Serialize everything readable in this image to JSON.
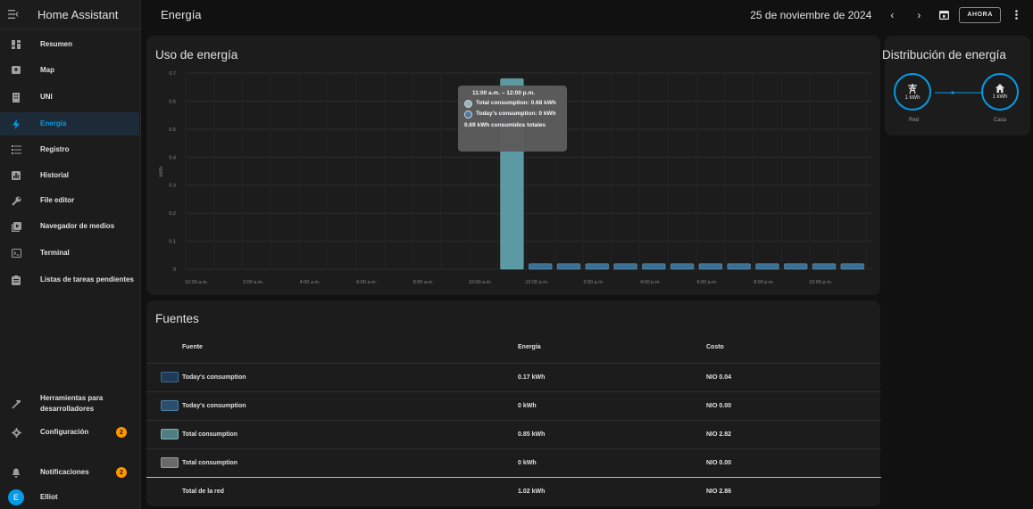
{
  "sidebar": {
    "title": "Home Assistant",
    "items": [
      {
        "label": "Resumen",
        "icon": "dashboard-icon"
      },
      {
        "label": "Map",
        "icon": "map-icon"
      },
      {
        "label": "UNI",
        "icon": "building-icon"
      },
      {
        "label": "Energía",
        "icon": "lightning-icon"
      },
      {
        "label": "Registro",
        "icon": "list-icon"
      },
      {
        "label": "Historial",
        "icon": "chart-box-icon"
      },
      {
        "label": "File editor",
        "icon": "wrench-icon"
      },
      {
        "label": "Navegador de medios",
        "icon": "play-box-icon"
      },
      {
        "label": "Terminal",
        "icon": "console-icon"
      },
      {
        "label": "Listas de tareas pendientes",
        "icon": "clipboard-list-icon"
      }
    ],
    "dev_tools": {
      "line1": "Herramientas para",
      "line2": "desarrolladores"
    },
    "config": {
      "label": "Configuración",
      "badge": "2"
    },
    "notifications": {
      "label": "Notificaciones",
      "badge": "2"
    },
    "user": {
      "initial": "E",
      "name": "Elliot"
    },
    "accent_color": "#039be5"
  },
  "topbar": {
    "title": "Energía",
    "date": "25 de noviembre de 2024",
    "now_label": "AHORA"
  },
  "usage_card": {
    "title": "Uso de energía"
  },
  "chart_data": {
    "type": "bar",
    "ylabel": "kWh",
    "yticks": [
      "0",
      "0.1",
      "0.2",
      "0.3",
      "0.4",
      "0.5",
      "0.6",
      "0.7"
    ],
    "ylim": [
      0,
      0.7
    ],
    "xticks": [
      "12:00 a.m.",
      "2:00 a.m.",
      "4:00 a.m.",
      "6:00 a.m.",
      "8:00 a.m.",
      "10:00 a.m.",
      "12:00 p.m.",
      "2:00 p.m.",
      "4:00 p.m.",
      "6:00 p.m.",
      "8:00 p.m.",
      "10:00 p.m."
    ],
    "hours": [
      "12:00 a.m.",
      "1:00 a.m.",
      "2:00 a.m.",
      "3:00 a.m.",
      "4:00 a.m.",
      "5:00 a.m.",
      "6:00 a.m.",
      "7:00 a.m.",
      "8:00 a.m.",
      "9:00 a.m.",
      "10:00 a.m.",
      "11:00 a.m.",
      "12:00 p.m.",
      "1:00 p.m.",
      "2:00 p.m.",
      "3:00 p.m.",
      "4:00 p.m.",
      "5:00 p.m.",
      "6:00 p.m.",
      "7:00 p.m.",
      "8:00 p.m.",
      "9:00 p.m.",
      "10:00 p.m.",
      "11:00 p.m."
    ],
    "series": [
      {
        "name": "Total consumption",
        "color": "#5b9aa3",
        "values": [
          0,
          0,
          0,
          0,
          0,
          0,
          0,
          0,
          0,
          0,
          0,
          0.68,
          0,
          0,
          0,
          0,
          0,
          0,
          0,
          0,
          0,
          0,
          0,
          0
        ]
      },
      {
        "name": "Today's consumption",
        "color": "#3a6f96",
        "values": [
          0,
          0,
          0,
          0,
          0,
          0,
          0,
          0,
          0,
          0,
          0,
          0,
          0.02,
          0.02,
          0.02,
          0.02,
          0.02,
          0.02,
          0.02,
          0.02,
          0.02,
          0.02,
          0.02,
          0.02
        ]
      }
    ],
    "grid": true
  },
  "tooltip": {
    "header": "11:00 a.m. – 12:00 p.m.",
    "line1": "Total consumption: 0.68 kWh",
    "line2": "Today's consumption: 0 kWh",
    "footer": "0.69 kWh consumidos totales"
  },
  "sources": {
    "title": "Fuentes",
    "headers": {
      "source": "Fuente",
      "energy": "Energía",
      "cost": "Costo"
    },
    "rows": [
      {
        "name": "Today's consumption",
        "energy": "0.17 kWh",
        "cost": "NIO 0.04",
        "fill": "#1e3a56",
        "border": "#3a6f96"
      },
      {
        "name": "Today's consumption",
        "energy": "0 kWh",
        "cost": "NIO 0.00",
        "fill": "#2c4d6b",
        "border": "#4a7fa8"
      },
      {
        "name": "Total consumption",
        "energy": "0.85 kWh",
        "cost": "NIO 2.82",
        "fill": "#4d7f83",
        "border": "#7fb2b6"
      },
      {
        "name": "Total consumption",
        "energy": "0 kWh",
        "cost": "NIO 0.00",
        "fill": "#6a6a6a",
        "border": "#9a9a9a"
      }
    ],
    "total": {
      "name": "Total de la red",
      "energy": "1.02 kWh",
      "cost": "NIO 2.86"
    }
  },
  "distribution": {
    "title": "Distribución de energía",
    "grid": {
      "value": "1 kWh",
      "label": "Red",
      "icon": "transmission-tower-icon"
    },
    "home": {
      "value": "1 kWh",
      "label": "Casa",
      "icon": "home-icon"
    }
  }
}
